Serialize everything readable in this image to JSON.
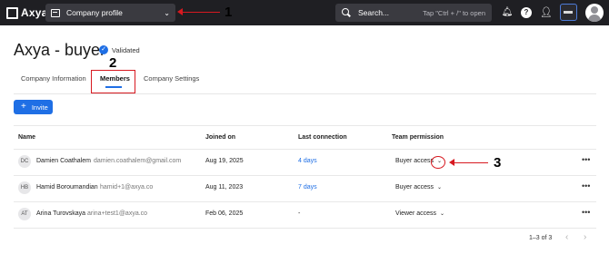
{
  "topbar": {
    "logo": "Axya",
    "profile_select": "Company profile",
    "search_placeholder": "Search...",
    "search_hint": "Tap \"Ctrl + /\" to open",
    "icons": [
      "bell-icon",
      "help-icon",
      "add-user-icon",
      "company-badge",
      "user-avatar"
    ]
  },
  "annotations": [
    "1",
    "2",
    "3"
  ],
  "page": {
    "title": "Axya - buyer",
    "validated": "Validated"
  },
  "tabs": [
    {
      "label": "Company Information",
      "active": false
    },
    {
      "label": "Members",
      "active": true
    },
    {
      "label": "Company Settings",
      "active": false
    }
  ],
  "invite_label": "Invite",
  "table": {
    "headers": {
      "name": "Name",
      "joined": "Joined on",
      "last": "Last connection",
      "perm": "Team permission"
    },
    "rows": [
      {
        "initials": "DC",
        "name": "Damien Coathalem",
        "email": "damien.coathalem@gmail.com",
        "joined": "Aug 19, 2025",
        "last": "4 days",
        "perm": "Buyer access"
      },
      {
        "initials": "HB",
        "name": "Hamid Boroumandian",
        "email": "hamid+1@axya.co",
        "joined": "Aug 11, 2023",
        "last": "7 days",
        "perm": "Buyer access"
      },
      {
        "initials": "AT",
        "name": "Arina Turovskaya",
        "email": "arina+test1@axya.co",
        "joined": "Feb 06, 2025",
        "last": "-",
        "perm": "Viewer access"
      }
    ]
  },
  "pagination": {
    "range": "1–3 of 3"
  },
  "colors": {
    "accent": "#1f6fe5",
    "annotation": "#d71920",
    "topbar": "#1f1f23"
  }
}
